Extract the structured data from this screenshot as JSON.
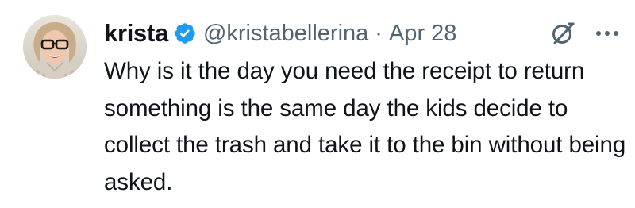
{
  "tweet": {
    "author": {
      "display_name": "krista",
      "handle": "@kristabellerina",
      "verified": true
    },
    "separator": "·",
    "date": "Apr 28",
    "text": "Why is it the day you need the receipt to return something is the same day the kids decide to collect the trash and take it to the bin without being asked."
  },
  "icons": {
    "verified": "verified-badge-icon",
    "grok": "grok-icon",
    "more": "more-options-icon"
  },
  "colors": {
    "verified_badge": "#1d9bf0",
    "secondary_text": "#536471",
    "primary_text": "#0f1419"
  }
}
